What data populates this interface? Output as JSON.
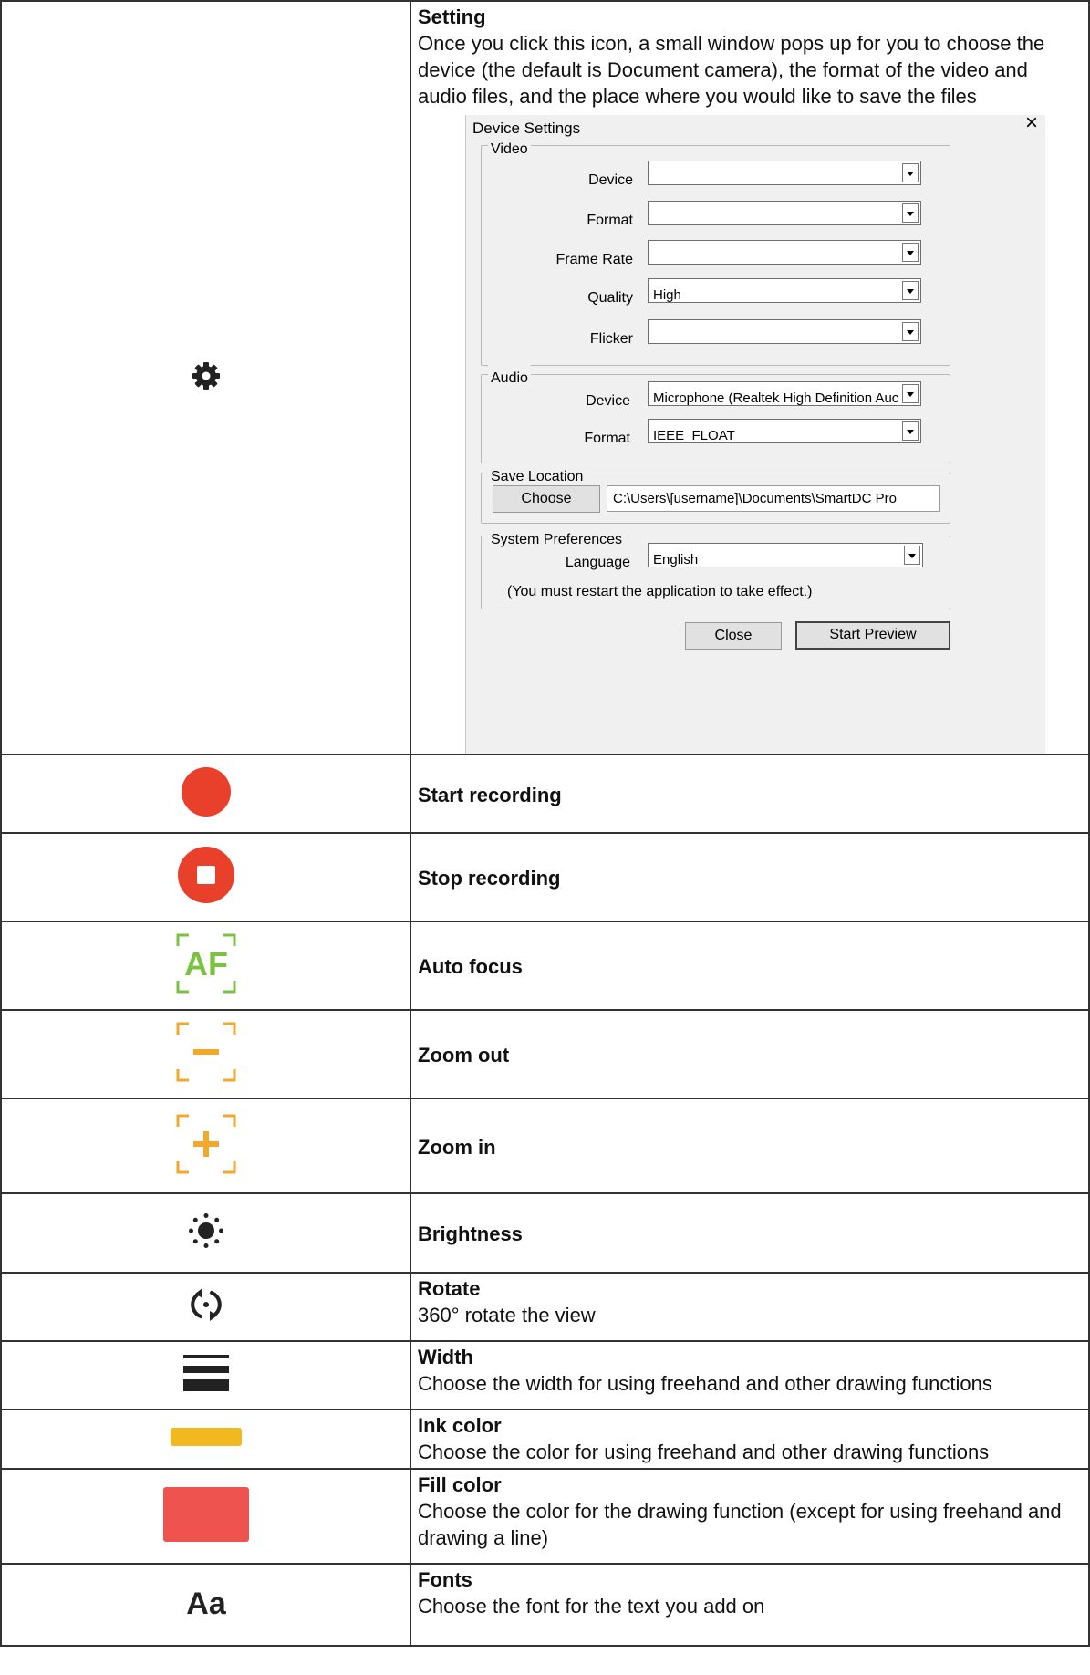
{
  "rows": [
    {
      "icon": "gear-icon",
      "title": "Setting",
      "desc": "Once you click this icon, a small window pops up for you to choose the device (the default is Document camera), the format of the video and audio files, and the place where you would like to save the files"
    },
    {
      "icon": "record-icon",
      "title": "Start recording"
    },
    {
      "icon": "stop-icon",
      "title": "Stop recording"
    },
    {
      "icon": "auto-focus-icon",
      "title": "Auto focus",
      "icon_text": "AF"
    },
    {
      "icon": "zoom-out-icon",
      "title": "Zoom out"
    },
    {
      "icon": "zoom-in-icon",
      "title": "Zoom in"
    },
    {
      "icon": "brightness-icon",
      "title": "Brightness"
    },
    {
      "icon": "rotate-icon",
      "title": "Rotate",
      "desc": "360° rotate the view"
    },
    {
      "icon": "width-icon",
      "title": "Width",
      "desc": "Choose the width for using freehand and other drawing functions"
    },
    {
      "icon": "ink-color-icon",
      "title": "Ink color",
      "desc": "Choose the color for using freehand and other drawing functions"
    },
    {
      "icon": "fill-color-icon",
      "title": "Fill color",
      "desc": "Choose the color for the drawing function (except for using freehand and drawing a line)"
    },
    {
      "icon": "fonts-icon",
      "title": "Fonts",
      "desc": "Choose the font for the text you add on",
      "icon_text": "Aa"
    }
  ],
  "dialog": {
    "title": "Device Settings",
    "close_glyph": "×",
    "video": {
      "label": "Video",
      "fields": [
        {
          "label": "Device",
          "value": ""
        },
        {
          "label": "Format",
          "value": ""
        },
        {
          "label": "Frame Rate",
          "value": ""
        },
        {
          "label": "Quality",
          "value": "High"
        },
        {
          "label": "Flicker",
          "value": ""
        }
      ]
    },
    "audio": {
      "label": "Audio",
      "fields": [
        {
          "label": "Device",
          "value": "Microphone (Realtek High Definition Auc"
        },
        {
          "label": "Format",
          "value": "IEEE_FLOAT"
        }
      ]
    },
    "save": {
      "label": "Save Location",
      "choose_button": "Choose",
      "path": "C:\\Users\\[username]\\Documents\\SmartDC Pro"
    },
    "prefs": {
      "label": "System Preferences",
      "language_label": "Language",
      "language_value": "English",
      "note": "(You must restart the application to take effect.)"
    },
    "close_button": "Close",
    "start_button": "Start Preview"
  },
  "colors": {
    "record_red": "#e8402a",
    "af_green": "#7cc242",
    "zoom_orange": "#f0a92a",
    "ink_yellow": "#f2b820",
    "fill_red": "#ef5350",
    "dark_icon": "#222222"
  }
}
